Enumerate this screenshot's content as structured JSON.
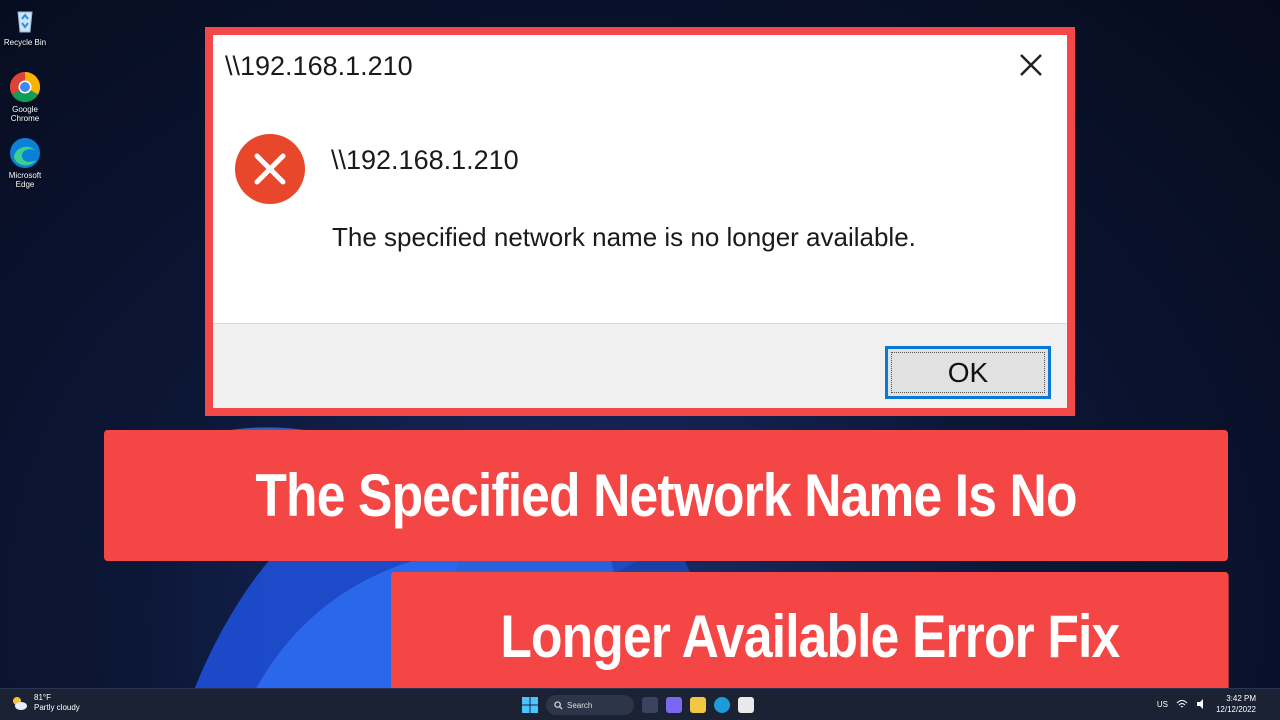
{
  "desktop": {
    "icons": [
      {
        "label": "Recycle Bin"
      },
      {
        "label": "Google\nChrome"
      },
      {
        "label": "Microsoft\nEdge"
      }
    ]
  },
  "dialog": {
    "title": "\\\\192.168.1.210",
    "host": "\\\\192.168.1.210",
    "message": "The specified network name is no longer available.",
    "ok_label": "OK",
    "icon": "error-icon"
  },
  "banner": {
    "line1": "The Specified Network Name Is No",
    "line2": "Longer Available Error Fix"
  },
  "taskbar": {
    "weather_temp": "81°F",
    "weather_desc": "Partly cloudy",
    "search_label": "Search",
    "language": "US",
    "time": "3:42 PM",
    "date": "12/12/2022"
  },
  "colors": {
    "banner_red": "#f54646",
    "ok_focus_blue": "#0a78d4",
    "error_red": "#e8472b"
  }
}
